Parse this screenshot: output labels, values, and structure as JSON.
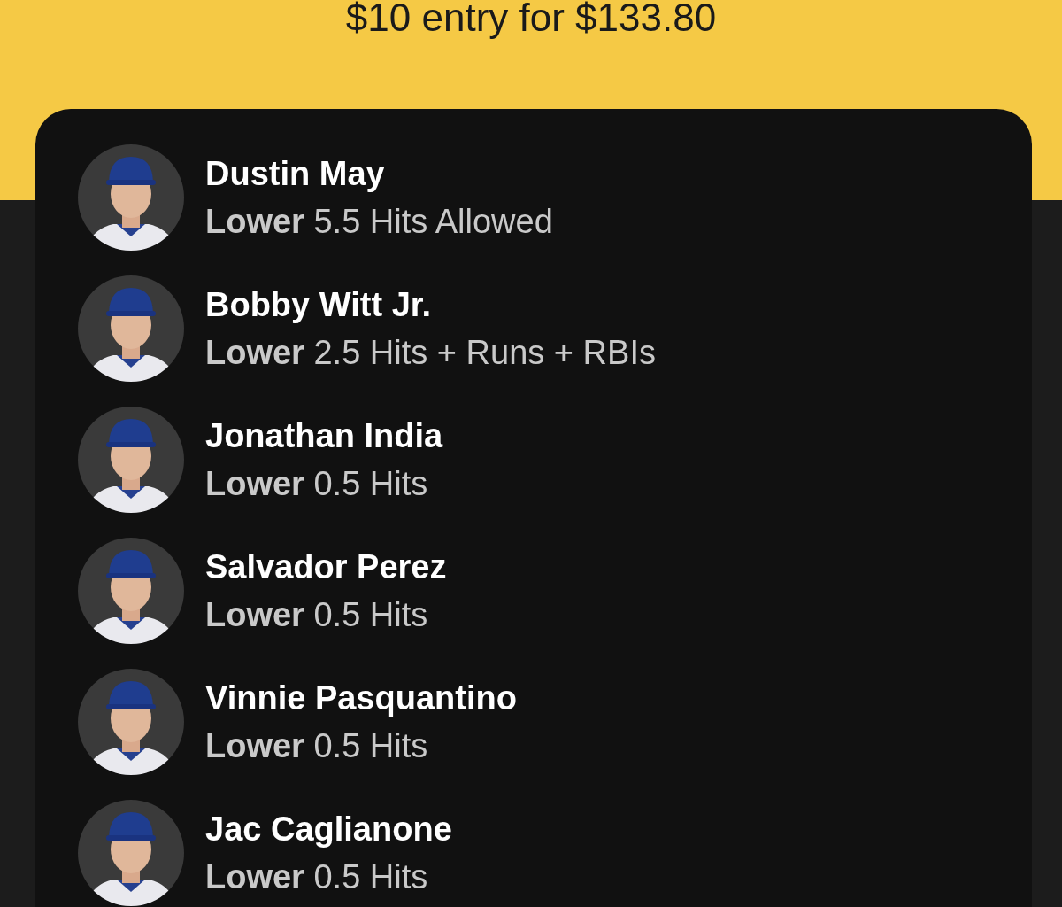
{
  "header": {
    "title": "$10 entry for $133.80"
  },
  "picks": [
    {
      "player": "Dustin May",
      "pick": "**Lower** 5.5 Hits Allowed"
    },
    {
      "player": "Bobby Witt Jr.",
      "pick": "**Lower** 2.5 Hits + Runs + RBIs"
    },
    {
      "player": "Jonathan India",
      "pick": "**Lower** 0.5 Hits"
    },
    {
      "player": "Salvador Perez",
      "pick": "**Lower** 0.5 Hits"
    },
    {
      "player": "Vinnie Pasquantino",
      "pick": "**Lower** 0.5 Hits"
    },
    {
      "player": "Jac Caglianone",
      "pick": "**Lower** 0.5 Hits"
    }
  ]
}
